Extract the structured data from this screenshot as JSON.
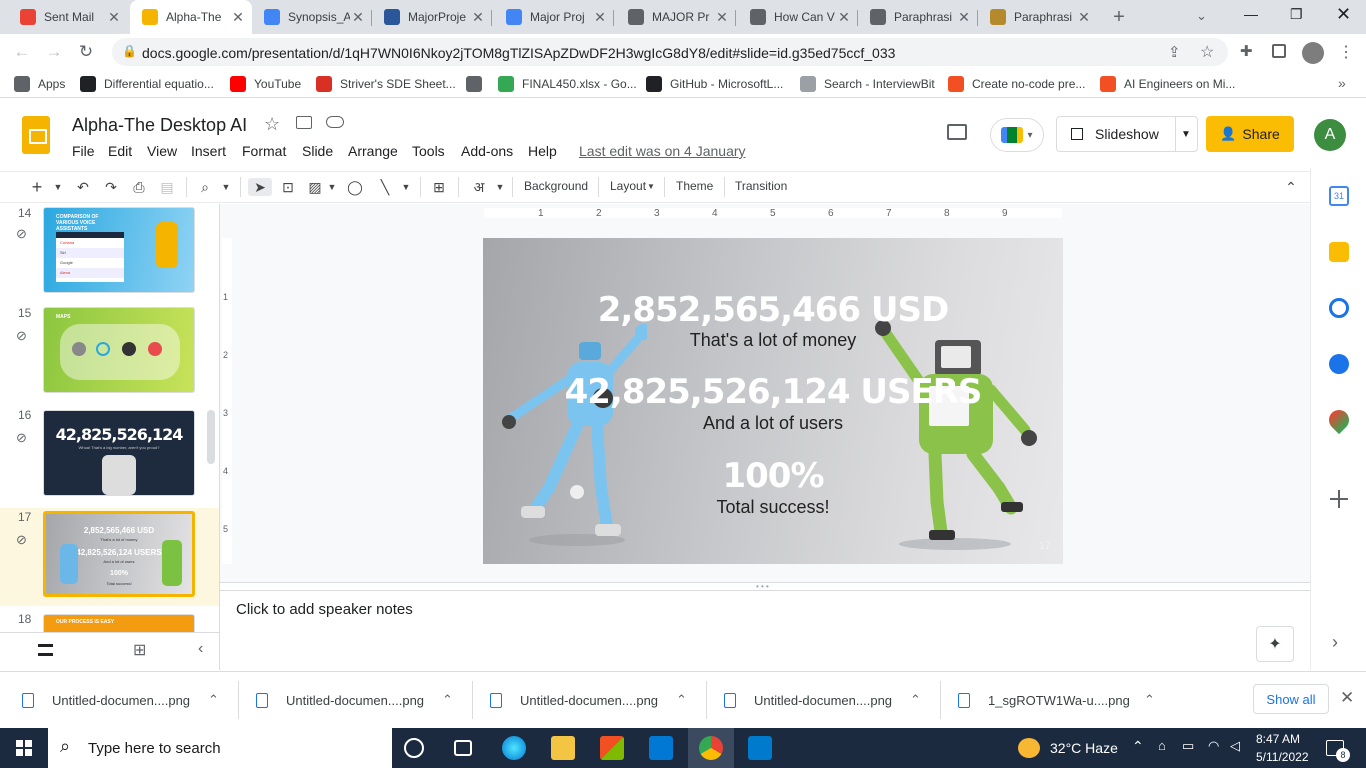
{
  "browser": {
    "tabs": [
      {
        "title": "Sent Mail",
        "icon": "gmail-icon",
        "color": "#ea4335"
      },
      {
        "title": "Alpha-The",
        "icon": "slides-icon",
        "color": "#f4b400",
        "active": true
      },
      {
        "title": "Synopsis_A",
        "icon": "docs-icon",
        "color": "#4285f4"
      },
      {
        "title": "MajorProje",
        "icon": "word-icon",
        "color": "#2b579a"
      },
      {
        "title": "Major Proj",
        "icon": "docs-icon",
        "color": "#4285f4"
      },
      {
        "title": "MAJOR Pr",
        "icon": "globe-icon",
        "color": "#5f6368"
      },
      {
        "title": "How Can V",
        "icon": "globe-icon",
        "color": "#5f6368"
      },
      {
        "title": "Paraphrasi",
        "icon": "quill-icon",
        "color": "#5f6368"
      },
      {
        "title": "Paraphrasi",
        "icon": "quill-icon",
        "color": "#b58a2c"
      }
    ],
    "url": "docs.google.com/presentation/d/1qH7WN0I6Nkoy2jTOM8gTlZISApZDwDF2H3wgIcG8dY8/edit#slide=id.g35ed75ccf_033",
    "bookmarks": [
      {
        "label": "Apps",
        "icon": "apps-icon",
        "color": "#5f6368"
      },
      {
        "label": "Differential equatio...",
        "icon": "wikipedia-icon",
        "color": "#202124"
      },
      {
        "label": "YouTube",
        "icon": "youtube-icon",
        "color": "#ff0000"
      },
      {
        "label": "Striver's SDE Sheet...",
        "icon": "tuf-icon",
        "color": "#d93025"
      },
      {
        "label": "",
        "icon": "globe-icon",
        "color": "#5f6368"
      },
      {
        "label": "FINAL450.xlsx - Go...",
        "icon": "drive-icon",
        "color": "#34a853"
      },
      {
        "label": "GitHub - MicrosoftL...",
        "icon": "github-icon",
        "color": "#202124"
      },
      {
        "label": "Search - InterviewBit",
        "icon": "interviewbit-icon",
        "color": "#9aa0a6"
      },
      {
        "label": "Create no-code pre...",
        "icon": "microsoft-icon",
        "color": "#f25022"
      },
      {
        "label": "AI Engineers on Mi...",
        "icon": "microsoft-icon",
        "color": "#f25022"
      }
    ]
  },
  "doc": {
    "title": "Alpha-The Desktop AI",
    "menu": [
      "File",
      "Edit",
      "View",
      "Insert",
      "Format",
      "Slide",
      "Arrange",
      "Tools",
      "Add-ons",
      "Help"
    ],
    "last_edit": "Last edit was on 4 January",
    "slideshow_label": "Slideshow",
    "share_label": "Share",
    "avatar_letter": "A"
  },
  "toolbar": {
    "background": "Background",
    "layout": "Layout",
    "theme": "Theme",
    "transition": "Transition",
    "hindi_glyph": "अ"
  },
  "ruler": {
    "marks": [
      "1",
      "2",
      "3",
      "4",
      "5",
      "6",
      "7",
      "8",
      "9"
    ],
    "vmarks": [
      "1",
      "2",
      "3",
      "4",
      "5"
    ]
  },
  "filmstrip": {
    "slides": [
      {
        "num": "14",
        "title": "COMPARISON OF VARIOUS VOICE ASSISTANTS",
        "rows": [
          "Cortana",
          "Siri",
          "Google",
          "Alexa"
        ]
      },
      {
        "num": "15",
        "title": "MAPS"
      },
      {
        "num": "16",
        "big": "42,825,526,124",
        "sub": "Whoa! That's a big number, aren't you proud?"
      },
      {
        "num": "17",
        "lines": [
          "2,852,565,466  USD",
          "That's a lot of money",
          "42,825,526,124 USERS",
          "And a lot of users",
          "100%",
          "Total success!"
        ]
      },
      {
        "num": "18",
        "title": "OUR PROCESS IS EASY"
      }
    ]
  },
  "slide": {
    "line1": "2,852,565,466  USD",
    "line1_sub": "That's a lot of money",
    "line2": "42,825,526,124 USERS",
    "line2_sub": "And a lot of users",
    "line3": "100%",
    "line3_sub": "Total success!",
    "page_number": "17"
  },
  "notes": {
    "placeholder": "Click to add speaker notes"
  },
  "downloads": [
    {
      "name": "Untitled-documen....png"
    },
    {
      "name": "Untitled-documen....png"
    },
    {
      "name": "Untitled-documen....png"
    },
    {
      "name": "Untitled-documen....png"
    },
    {
      "name": "1_sgROTW1Wa-u....png"
    }
  ],
  "downloads_show_all": "Show all",
  "taskbar": {
    "search_placeholder": "Type here to search",
    "weather": "32°C  Haze",
    "time": "8:47 AM",
    "date": "5/11/2022",
    "notification_count": "8"
  }
}
